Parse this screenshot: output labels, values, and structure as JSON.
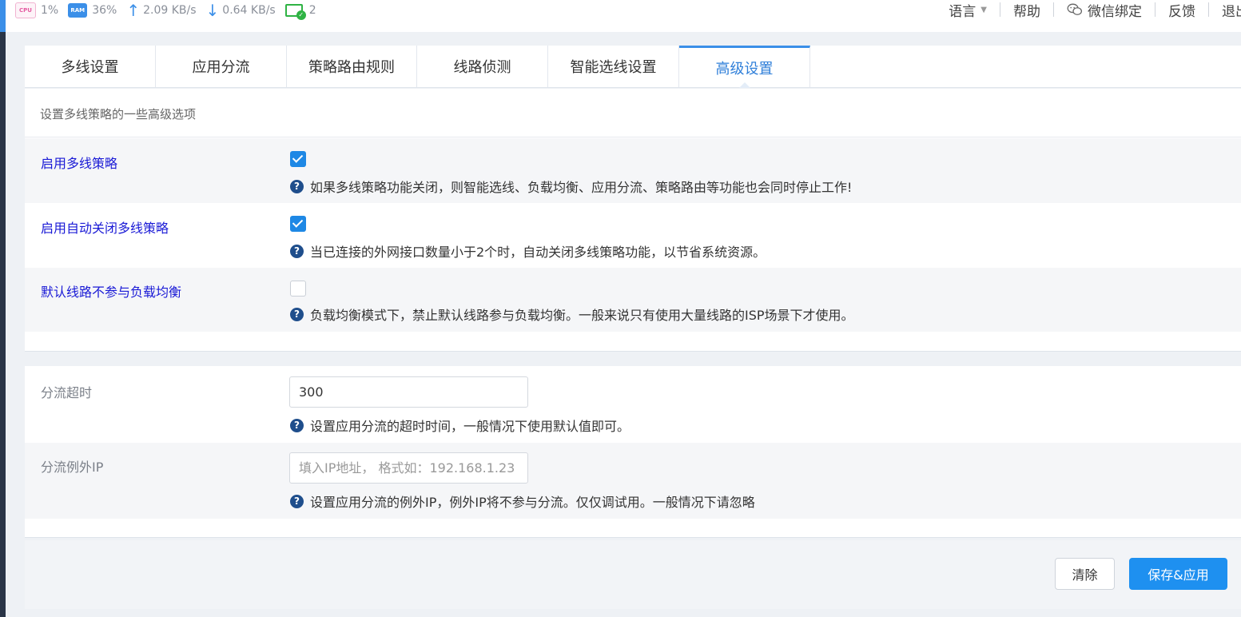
{
  "topbar": {
    "cpu_chip": "CPU",
    "cpu_value": "1%",
    "ram_chip": "RAM",
    "ram_value": "36%",
    "upload_value": "2.09 KB/s",
    "download_value": "0.64 KB/s",
    "devices_value": "2",
    "nav": {
      "language": "语言",
      "help": "帮助",
      "wechat": "微信绑定",
      "feedback": "反馈",
      "logout": "退出"
    }
  },
  "tabs": [
    {
      "label": "多线设置"
    },
    {
      "label": "应用分流"
    },
    {
      "label": "策略路由规则"
    },
    {
      "label": "线路侦测"
    },
    {
      "label": "智能选线设置"
    },
    {
      "label": "高级设置"
    }
  ],
  "active_tab": "高级设置",
  "panel1": {
    "description": "设置多线策略的一些高级选项",
    "rows": [
      {
        "label": "启用多线策略",
        "checked": true,
        "help": "如果多线策略功能关闭，则智能选线、负载均衡、应用分流、策略路由等功能也会同时停止工作!"
      },
      {
        "label": "启用自动关闭多线策略",
        "checked": true,
        "help": "当已连接的外网接口数量小于2个时，自动关闭多线策略功能，以节省系统资源。"
      },
      {
        "label": "默认线路不参与负载均衡",
        "checked": false,
        "help": "负载均衡模式下，禁止默认线路参与负载均衡。一般来说只有使用大量线路的ISP场景下才使用。"
      }
    ]
  },
  "panel2": {
    "rows": [
      {
        "label": "分流超时",
        "value": "300",
        "placeholder": "",
        "help": "设置应用分流的超时时间，一般情况下使用默认值即可。"
      },
      {
        "label": "分流例外IP",
        "value": "",
        "placeholder": "填入IP地址， 格式如：192.168.1.23",
        "help": "设置应用分流的例外IP，例外IP将不参与分流。仅仅调试用。一般情况下请忽略"
      }
    ]
  },
  "buttons": {
    "clear": "清除",
    "save": "保存&应用"
  },
  "colors": {
    "accent": "#1e90f0",
    "label_blue": "#1a1ad6",
    "help_icon": "#1f4e8c"
  }
}
